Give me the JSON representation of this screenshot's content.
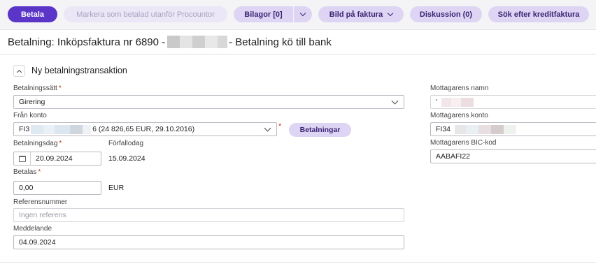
{
  "toolbar": {
    "pay": "Betala",
    "mark_paid": "Markera som betalad utanför Procountor",
    "attachments": "Bilagor [0]",
    "image_on_invoice": "Bild på faktura",
    "discussion": "Diskussion (0)",
    "search_credit_invoice": "Sök efter kreditfaktura"
  },
  "page": {
    "title_prefix": "Betalning: Inköpsfaktura nr 6890 -",
    "title_suffix": "- Betalning kö till bank"
  },
  "section": {
    "title": "Ny betalningstransaktion"
  },
  "form": {
    "payment_method_label": "Betalningssätt",
    "payment_method_value": "Girering",
    "from_account_label": "Från konto",
    "from_account_prefix": "FI3",
    "from_account_suffix": "6 (24 826,65 EUR, 29.10.2016)",
    "payments_button": "Betalningar",
    "payment_date_label": "Betalningsdag",
    "payment_date_value": "20.09.2024",
    "due_date_label": "Förfallodag",
    "due_date_value": "15.09.2024",
    "amount_label": "Betalas",
    "amount_value": "0,00",
    "currency": "EUR",
    "reference_label": "Referensnummer",
    "reference_placeholder": "Ingen referens",
    "message_label": "Meddelande",
    "message_value": "04.09.2024",
    "required_mark": "*"
  },
  "recipient": {
    "name_label": "Mottagarens namn",
    "name_value": "'",
    "account_label": "Mottagarens konto",
    "account_prefix": "FI34",
    "bic_label": "Mottagarens BIC-kod",
    "bic_value": "AABAFI22"
  },
  "colors": {
    "primary": "#5a35c8",
    "soft": "#ddd5f3",
    "required": "#c0392b"
  }
}
